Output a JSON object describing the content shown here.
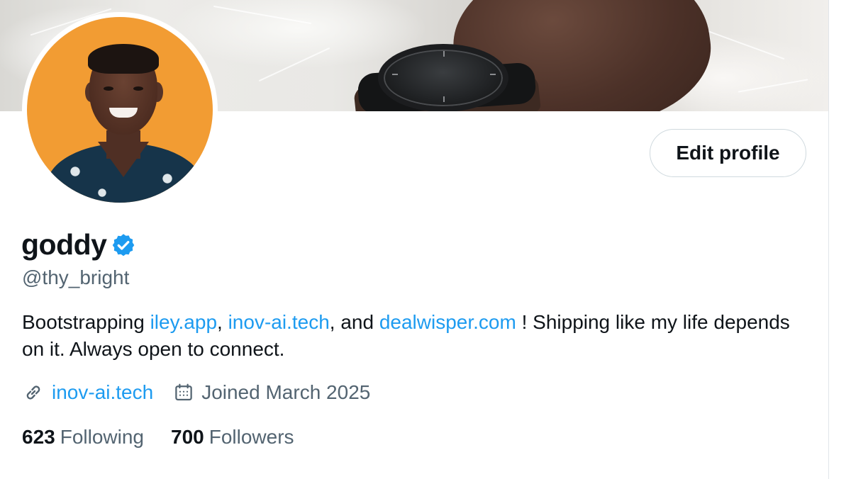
{
  "profile": {
    "display_name": "goddy",
    "handle": "@thy_bright",
    "edit_button_label": "Edit profile",
    "bio": {
      "part1": "Bootstrapping ",
      "link1": "iley.app",
      "sep1": ", ",
      "link2": "inov-ai.tech",
      "sep2": ", and ",
      "link3": "dealwisper.com",
      "part2": " ! Shipping like my life depends on it. Always open to connect."
    },
    "website": "inov-ai.tech",
    "joined": "Joined March 2025",
    "following_count": "623",
    "following_label": "Following",
    "followers_count": "700",
    "followers_label": "Followers"
  },
  "icons": {
    "verified": "verified-badge-icon",
    "link": "link-icon",
    "calendar": "calendar-icon"
  },
  "colors": {
    "accent": "#1d9bf0",
    "secondary_text": "#536471",
    "primary_text": "#0f1419",
    "avatar_background": "#f29c33"
  }
}
